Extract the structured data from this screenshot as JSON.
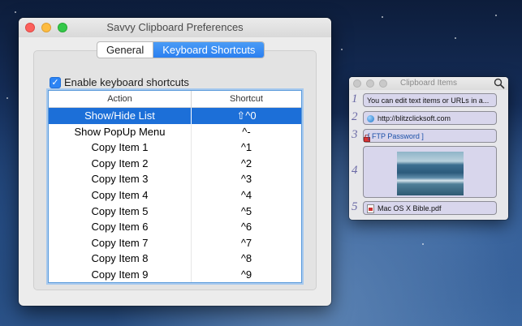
{
  "preferences": {
    "title": "Savvy Clipboard Preferences",
    "tabs": [
      {
        "label": "General",
        "active": false
      },
      {
        "label": "Keyboard Shortcuts",
        "active": true
      }
    ],
    "enable_shortcuts": {
      "label": "Enable keyboard shortcuts",
      "checked": true
    },
    "table": {
      "columns": [
        "Action",
        "Shortcut"
      ],
      "rows": [
        {
          "action": "Show/Hide List",
          "shortcut": "⇧^0",
          "selected": true
        },
        {
          "action": "Show PopUp Menu",
          "shortcut": "^-",
          "selected": false
        },
        {
          "action": "Copy Item 1",
          "shortcut": "^1",
          "selected": false
        },
        {
          "action": "Copy Item 2",
          "shortcut": "^2",
          "selected": false
        },
        {
          "action": "Copy Item 3",
          "shortcut": "^3",
          "selected": false
        },
        {
          "action": "Copy Item 4",
          "shortcut": "^4",
          "selected": false
        },
        {
          "action": "Copy Item 5",
          "shortcut": "^5",
          "selected": false
        },
        {
          "action": "Copy Item 6",
          "shortcut": "^6",
          "selected": false
        },
        {
          "action": "Copy Item 7",
          "shortcut": "^7",
          "selected": false
        },
        {
          "action": "Copy Item 8",
          "shortcut": "^8",
          "selected": false
        },
        {
          "action": "Copy Item 9",
          "shortcut": "^9",
          "selected": false
        }
      ]
    }
  },
  "clipboard": {
    "title": "Clipboard Items",
    "items": [
      {
        "number": "1",
        "text": "You can edit text items or URLs in a...",
        "icon": "none"
      },
      {
        "number": "2",
        "text": "http://blitzclicksoft.com",
        "icon": "globe-icon"
      },
      {
        "number": "3",
        "text": "[ FTP Password ]",
        "icon": "lock-icon"
      },
      {
        "number": "4",
        "text": "",
        "icon": "image-thumbnail"
      },
      {
        "number": "5",
        "text": "Mac OS X Bible.pdf",
        "icon": "pdf-icon"
      }
    ]
  },
  "colors": {
    "accent": "#1c6fd8",
    "tab_active": "#2b7ff0",
    "clip_item_bg": "#d8d6ec",
    "clip_number": "#6b6aa6"
  }
}
